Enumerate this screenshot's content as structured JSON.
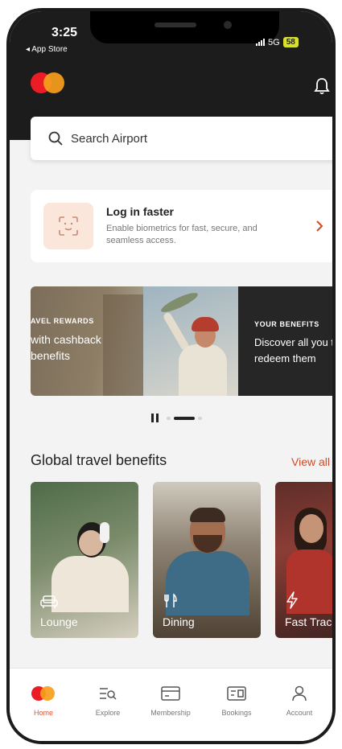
{
  "status_bar": {
    "time": "3:25",
    "back_label": "◂ App Store",
    "network": "5G",
    "battery": "58"
  },
  "header": {
    "logo_icon": "mastercard-logo",
    "notification_icon": "bell-icon"
  },
  "search": {
    "placeholder": "Search Airport"
  },
  "login_card": {
    "title": "Log in faster",
    "subtitle": "Enable biometrics for fast, secure, and seamless access.",
    "icon": "face-id-icon"
  },
  "carousel": {
    "slides": [
      {
        "tag": "AVEL REWARDS",
        "text": "with cashback benefits"
      },
      {
        "tag": "YOUR BENEFITS",
        "text": "Discover all you to redeem them"
      }
    ],
    "active_index": 1
  },
  "benefits": {
    "title": "Global travel benefits",
    "view_all": "View all",
    "items": [
      {
        "label": "Lounge",
        "icon": "armchair-icon"
      },
      {
        "label": "Dining",
        "icon": "fork-knife-icon"
      },
      {
        "label": "Fast Track",
        "icon": "lightning-icon"
      }
    ]
  },
  "bottom_nav": {
    "items": [
      {
        "label": "Home",
        "icon": "mastercard-logo"
      },
      {
        "label": "Explore",
        "icon": "explore-icon"
      },
      {
        "label": "Membership",
        "icon": "card-icon"
      },
      {
        "label": "Bookings",
        "icon": "bookings-icon"
      },
      {
        "label": "Account",
        "icon": "person-icon"
      }
    ],
    "active": "Home"
  },
  "colors": {
    "accent": "#cf4a26",
    "header_bg": "#1c1c1c",
    "brand_red": "#eb1c26",
    "brand_orange": "#f79e1b"
  }
}
